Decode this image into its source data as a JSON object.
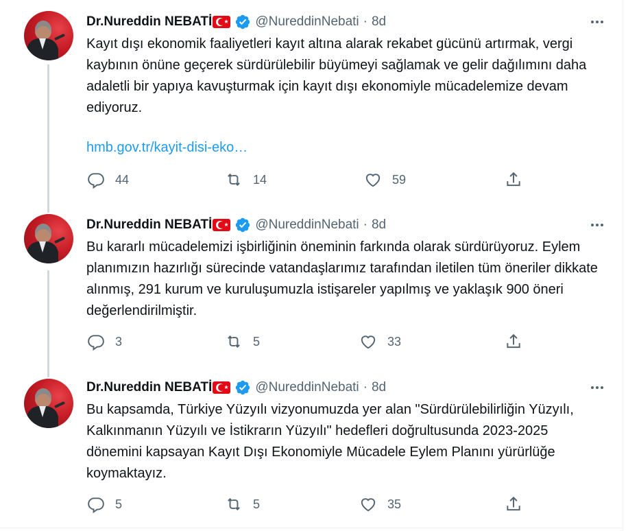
{
  "tweets": [
    {
      "author": {
        "name": "Dr.Nureddin NEBATİ",
        "handle": "@NureddinNebati",
        "flag": "turkey-flag",
        "verified": true
      },
      "time": "8d",
      "text": "Kayıt dışı ekonomik faaliyetleri kayıt altına alarak rekabet gücünü artırmak, vergi kaybının önüne geçerek sürdürülebilir büyümeyi sağlamak ve gelir dağılımını daha adaletli bir yapıya kavuşturmak için kayıt dışı ekonomiyle mücadelemize devam ediyoruz.",
      "link": "hmb.gov.tr/kayit-disi-eko…",
      "stats": {
        "replies": "44",
        "retweets": "14",
        "likes": "59"
      }
    },
    {
      "author": {
        "name": "Dr.Nureddin NEBATİ",
        "handle": "@NureddinNebati",
        "flag": "turkey-flag",
        "verified": true
      },
      "time": "8d",
      "text": "Bu kararlı mücadelemizi işbirliğinin öneminin farkında olarak sürdürüyoruz. Eylem planımızın hazırlığı sürecinde vatandaşlarımız tarafından iletilen tüm öneriler dikkate alınmış, 291 kurum ve kuruluşumuzla istişareler yapılmış ve yaklaşık 900 öneri değerlendirilmiştir.",
      "stats": {
        "replies": "3",
        "retweets": "5",
        "likes": "33"
      }
    },
    {
      "author": {
        "name": "Dr.Nureddin NEBATİ",
        "handle": "@NureddinNebati",
        "flag": "turkey-flag",
        "verified": true
      },
      "time": "8d",
      "text": "Bu kapsamda, Türkiye Yüzyılı vizyonumuzda yer alan \"Sürdürülebilirliğin Yüzyılı, Kalkınmanın Yüzyılı ve İstikrarın Yüzyılı\" hedefleri doğrultusunda 2023-2025 dönemini kapsayan Kayıt Dışı Ekonomiyle Mücadele Eylem Planını yürürlüğe koymaktayız.",
      "stats": {
        "replies": "5",
        "retweets": "5",
        "likes": "35"
      }
    }
  ],
  "separator": "·",
  "colors": {
    "verified": "#1d9bf0",
    "link": "#1d9bf0",
    "muted": "#536471",
    "thread_line": "#cfd9de"
  }
}
